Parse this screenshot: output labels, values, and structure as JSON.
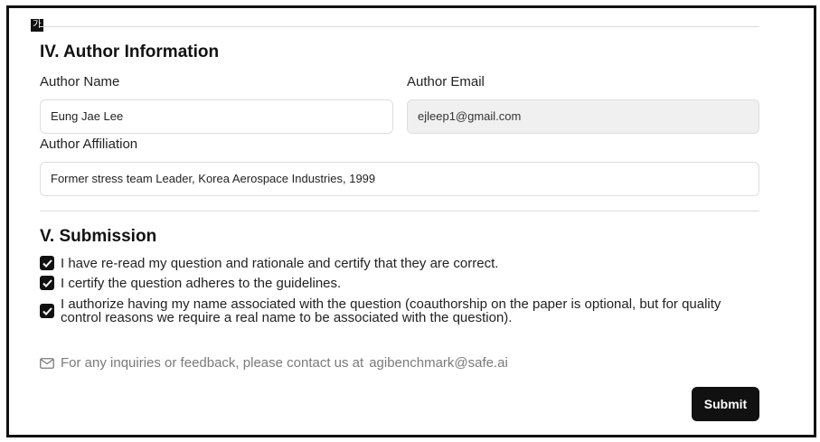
{
  "ime_indicator": "가",
  "author_section": {
    "title": "IV. Author Information",
    "name_label": "Author Name",
    "name_value": "Eung Jae Lee",
    "email_label": "Author Email",
    "email_value": "ejleep1@gmail.com",
    "affiliation_label": "Author Affiliation",
    "affiliation_value": "Former stress team Leader, Korea Aerospace Industries, 1999"
  },
  "submission_section": {
    "title": "V. Submission",
    "checkboxes": [
      {
        "label": "I have re-read my question and rationale and certify that they are correct.",
        "checked": true
      },
      {
        "label": "I certify the question adheres to the guidelines.",
        "checked": true
      },
      {
        "label": "I authorize having my name associated with the question (coauthorship on the paper is optional, but for quality control reasons we require a real name to be associated with the question).",
        "checked": true
      }
    ]
  },
  "contact": {
    "icon": "mail-icon",
    "text": "For any inquiries or feedback, please contact us at",
    "email": "agibenchmark@safe.ai"
  },
  "submit_label": "Submit"
}
